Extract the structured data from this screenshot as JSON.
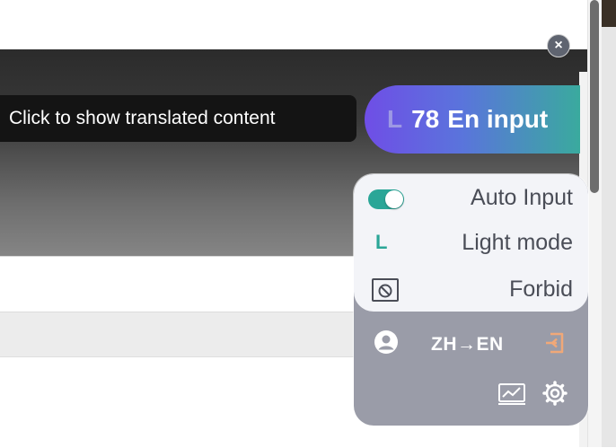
{
  "tooltip": {
    "text": "Click to show translated content"
  },
  "pill": {
    "mode_letter": "L",
    "count": "78",
    "label": "En input"
  },
  "menu": {
    "auto_input_label": "Auto Input",
    "auto_input_enabled": true,
    "light_mode_letter": "L",
    "light_mode_label": "Light mode",
    "forbid_label": "Forbid"
  },
  "tools": {
    "direction_label": "ZH→EN"
  },
  "close_label": "×",
  "colors": {
    "accent_teal": "#2aa697",
    "pill_purple": "#6f4ee6",
    "exit_orange": "#f0a878"
  }
}
